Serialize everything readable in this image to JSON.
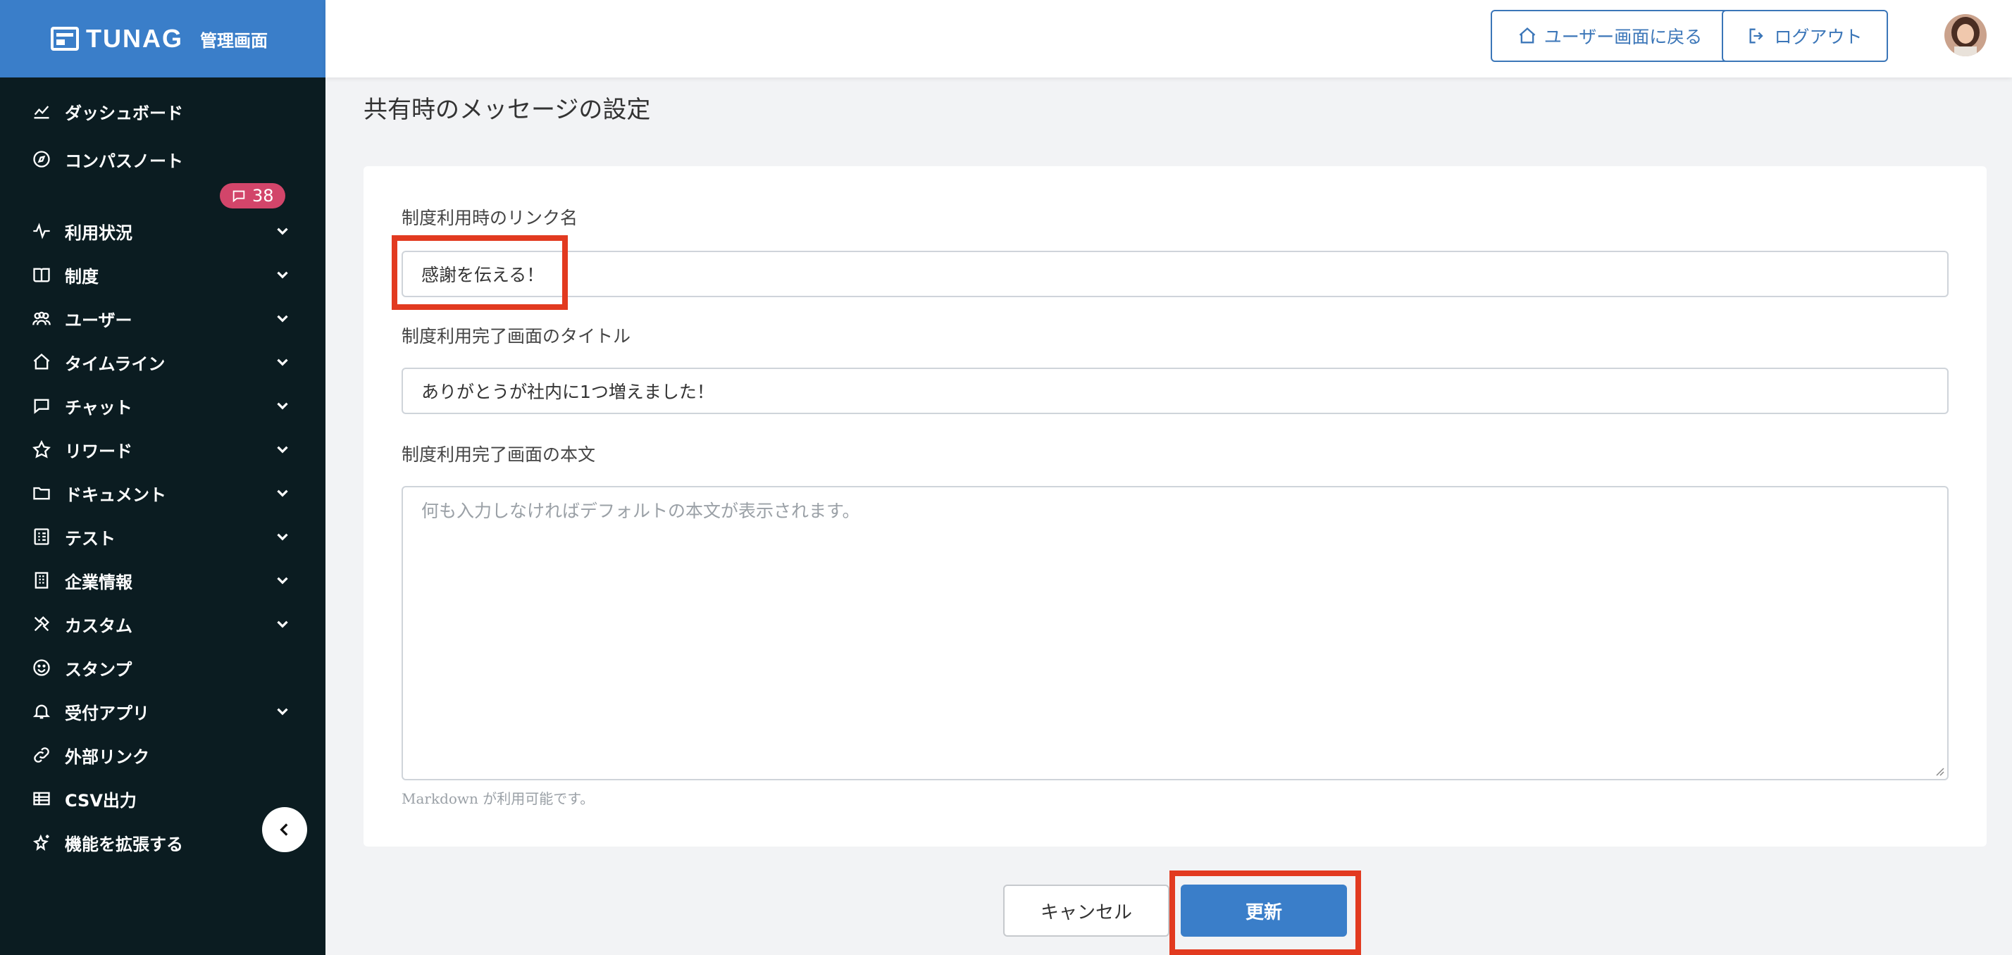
{
  "brand": {
    "name": "TUNAG",
    "subtitle": "管理画面"
  },
  "sidebar": {
    "badge_count": "38",
    "items": [
      {
        "label": "ダッシュボード",
        "icon": "chart-line-icon",
        "chevron": false
      },
      {
        "label": "コンパスノート",
        "icon": "compass-icon",
        "chevron": false
      },
      {
        "label": "利用状況",
        "icon": "activity-icon",
        "chevron": true
      },
      {
        "label": "制度",
        "icon": "book-icon",
        "chevron": true
      },
      {
        "label": "ユーザー",
        "icon": "users-icon",
        "chevron": true
      },
      {
        "label": "タイムライン",
        "icon": "home-icon",
        "chevron": true
      },
      {
        "label": "チャット",
        "icon": "chat-icon",
        "chevron": true
      },
      {
        "label": "リワード",
        "icon": "star-icon",
        "chevron": true
      },
      {
        "label": "ドキュメント",
        "icon": "folder-icon",
        "chevron": true
      },
      {
        "label": "テスト",
        "icon": "checklist-icon",
        "chevron": true
      },
      {
        "label": "企業情報",
        "icon": "building-icon",
        "chevron": true
      },
      {
        "label": "カスタム",
        "icon": "tools-icon",
        "chevron": true
      },
      {
        "label": "スタンプ",
        "icon": "smile-icon",
        "chevron": false
      },
      {
        "label": "受付アプリ",
        "icon": "bell-icon",
        "chevron": true
      },
      {
        "label": "外部リンク",
        "icon": "link-icon",
        "chevron": false
      },
      {
        "label": "CSV出力",
        "icon": "table-icon",
        "chevron": false
      },
      {
        "label": "機能を拡張する",
        "icon": "sparkle-star-icon",
        "chevron": false
      }
    ]
  },
  "header": {
    "back_to_user_label": "ユーザー画面に戻る",
    "logout_label": "ログアウト"
  },
  "main": {
    "page_title": "共有時のメッセージの設定",
    "link_name_label": "制度利用時のリンク名",
    "link_name_value": "感謝を伝える！",
    "complete_title_label": "制度利用完了画面のタイトル",
    "complete_title_value": "ありがとうが社内に1つ増えました！",
    "complete_body_label": "制度利用完了画面の本文",
    "complete_body_placeholder": "何も入力しなければデフォルトの本文が表示されます。",
    "markdown_hint": "Markdown が利用可能です。",
    "cancel_label": "キャンセル",
    "update_label": "更新"
  },
  "colors": {
    "brand_blue": "#3a7ec9",
    "sidebar_bg": "#0b1c21",
    "badge_pink": "#d2456a",
    "highlight_red": "#e23a20"
  }
}
